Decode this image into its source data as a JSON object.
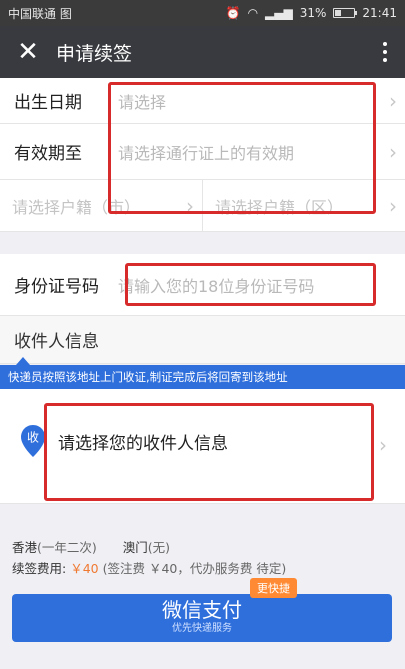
{
  "status_bar": {
    "carrier": "中国联通 图",
    "battery": "31%",
    "time": "21:41"
  },
  "nav": {
    "title": "申请续签"
  },
  "form": {
    "birth_label": "出生日期",
    "birth_placeholder": "请选择",
    "expiry_label": "有效期至",
    "expiry_placeholder": "请选择通行证上的有效期",
    "hukou_city": "请选择户籍（市）",
    "hukou_district": "请选择户籍（区）",
    "id_label": "身份证号码",
    "id_placeholder": "请输入您的18位身份证号码"
  },
  "receiver": {
    "section_title": "收件人信息",
    "notice": "快递员按照该地址上门收证,制证完成后将回寄到该地址",
    "pin_label": "收",
    "select_text": "请选择您的收件人信息"
  },
  "fees": {
    "hk_label": "香港",
    "hk_note": "(一年二次)",
    "mo_label": "澳门",
    "mo_note": "(无)",
    "fee_label": "续签费用:",
    "fee_price": "￥40",
    "fee_detail": "(签注费 ￥40，代办服务费 待定)"
  },
  "pay": {
    "badge": "更快捷",
    "button_label": "微信支付",
    "button_sub": "优先快递服务"
  },
  "colors": {
    "accent": "#2f6fdc",
    "highlight": "#d72a2a",
    "price": "#f07a32"
  }
}
